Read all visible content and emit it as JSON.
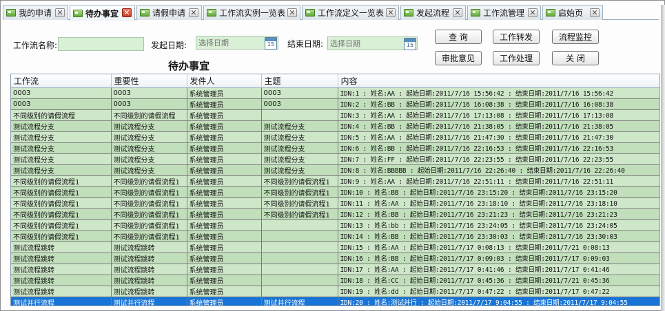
{
  "tabs": [
    {
      "label": "我的申请",
      "close": "✕",
      "active": false
    },
    {
      "label": "待办事宜",
      "close": "✕",
      "active": true
    },
    {
      "label": "请假申请",
      "close": "✕",
      "active": false
    },
    {
      "label": "工作流实例一览表",
      "close": "✕",
      "active": false
    },
    {
      "label": "工作流定义一览表",
      "close": "✕",
      "active": false
    },
    {
      "label": "发起流程",
      "close": "✕",
      "active": false
    },
    {
      "label": "工作流管理",
      "close": "✕",
      "active": false
    },
    {
      "label": "启始页",
      "close": "✕",
      "active": false
    }
  ],
  "filters": {
    "workflow_name_label": "工作流名称:",
    "workflow_name_value": "",
    "start_date_label": "发起日期:",
    "start_date_placeholder": "选择日期",
    "end_date_label": "结束日期:",
    "end_date_placeholder": "选择日期",
    "calendar_icon_text": "15"
  },
  "buttons": {
    "query": "查  询",
    "forward": "工作转发",
    "monitor": "流程监控",
    "approval_opinion": "审批意见",
    "handle": "工作处理",
    "close": "关  闭"
  },
  "page_title": "待办事宜",
  "table": {
    "columns": [
      "工作流",
      "重要性",
      "发件人",
      "主题",
      "内容"
    ],
    "rows": [
      [
        "0003",
        "0003",
        "系统管理员",
        "0003",
        "IDN:1  :  姓名:AA  :  起始日期:2011/7/16 15:56:42  :  结束日期:2011/7/16 15:56:42"
      ],
      [
        "0003",
        "0003",
        "系统管理员",
        "0003",
        "IDN:2  :  姓名:BB  :  起始日期:2011/7/16 16:08:38  :  结束日期:2011/7/16 16:08:38"
      ],
      [
        "不同级别的请假流程",
        "不同级别的请假流程",
        "系统管理员",
        "",
        "IDN:3  :  姓名:AA  :  起始日期:2011/7/16 17:13:08  :  结束日期:2011/7/16 17:13:08"
      ],
      [
        "测试流程分支",
        "测试流程分支",
        "系统管理员",
        "测试流程分支",
        "IDN:4  :  姓名:BB  :  起始日期:2011/7/16 21:38:05  :  结束日期:2011/7/16 21:38:05"
      ],
      [
        "测试流程分支",
        "测试流程分支",
        "系统管理员",
        "测试流程分支",
        "IDN:5  :  姓名:AA  :  起始日期:2011/7/16 21:47:30  :  结束日期:2011/7/16 21:47:30"
      ],
      [
        "测试流程分支",
        "测试流程分支",
        "系统管理员",
        "测试流程分支",
        "IDN:6  :  姓名:BB  :  起始日期:2011/7/16 22:16:53  :  结束日期:2011/7/16 22:16:53"
      ],
      [
        "测试流程分支",
        "测试流程分支",
        "系统管理员",
        "测试流程分支",
        "IDN:7  :  姓名:FF  :  起始日期:2011/7/16 22:23:55  :  结束日期:2011/7/16 22:23:55"
      ],
      [
        "测试流程分支",
        "测试流程分支",
        "系统管理员",
        "测试流程分支",
        "IDN:8  :  姓名:BBBBB  :  起始日期:2011/7/16 22:26:40  :  结束日期:2011/7/16 22:26:40"
      ],
      [
        "不同级别的请假流程1",
        "不同级别的请假流程1",
        "系统管理员",
        "不同级别的请假流程1",
        "IDN:9  :  姓名:AA  :  起始日期:2011/7/16 22:51:11  :  结束日期:2011/7/16 22:51:11"
      ],
      [
        "不同级别的请假流程1",
        "不同级别的请假流程1",
        "系统管理员",
        "不同级别的请假流程1",
        "IDN:10  :  姓名:BB  :  起始日期:2011/7/16 23:15:20  :  结束日期:2011/7/16 23:15:20"
      ],
      [
        "不同级别的请假流程1",
        "不同级别的请假流程1",
        "系统管理员",
        "不同级别的请假流程1",
        "IDN:11  :  姓名:AA  :  起始日期:2011/7/16 23:18:10  :  结束日期:2011/7/16 23:18:10"
      ],
      [
        "不同级别的请假流程1",
        "不同级别的请假流程1",
        "系统管理员",
        "不同级别的请假流程1",
        "IDN:12  :  姓名:BB  :  起始日期:2011/7/16 23:21:23  :  结束日期:2011/7/16 23:21:23"
      ],
      [
        "不同级别的请假流程1",
        "不同级别的请假流程1",
        "系统管理员",
        "",
        "IDN:13  :  姓名:bb  :  起始日期:2011/7/16 23:24:05  :  结束日期:2011/7/16 23:24:05"
      ],
      [
        "不同级别的请假流程1",
        "不同级别的请假流程1",
        "系统管理员",
        "",
        "IDN:14  :  姓名:BB  :  起始日期:2011/7/16 23:30:03  :  结束日期:2011/7/16 23:30:03"
      ],
      [
        "测试流程跳转",
        "测试流程跳转",
        "系统管理员",
        "",
        "IDN:15  :  姓名:AA  :  起始日期:2011/7/17 0:08:13  :  结束日期:2011/7/21 0:08:13"
      ],
      [
        "测试流程跳转",
        "测试流程跳转",
        "系统管理员",
        "",
        "IDN:16  :  姓名:BB  :  起始日期:2011/7/17 0:09:03  :  结束日期:2011/7/17 0:09:03"
      ],
      [
        "测试流程跳转",
        "测试流程跳转",
        "系统管理员",
        "",
        "IDN:17  :  姓名:AA  :  起始日期:2011/7/17 0:41:46  :  结束日期:2011/7/17 0:41:46"
      ],
      [
        "测试流程跳转",
        "测试流程跳转",
        "系统管理员",
        "",
        "IDN:18  :  姓名:CC  :  起始日期:2011/7/17 0:45:36  :  结束日期:2011/7/21 0:45:36"
      ],
      [
        "测试流程跳转",
        "测试流程跳转",
        "系统管理员",
        "",
        "IDN:19  :  姓名:dd  :  起始日期:2011/7/17 0:47:22  :  结束日期:2011/7/17 0:47:22"
      ],
      [
        "测试并行流程",
        "测试并行流程",
        "系统管理员",
        "测试并行流程",
        "IDN:20  :  姓名:测试并行  :  起始日期:2011/7/17 9:04:55  :  结束日期:2011/7/17 9:04:55"
      ]
    ],
    "selected_row": 19
  },
  "colors": {
    "row_green": "#cfe7c9",
    "input_green": "#d9f0d6",
    "selected_blue": "#1874d6",
    "active_close_red": "#c73b22"
  }
}
